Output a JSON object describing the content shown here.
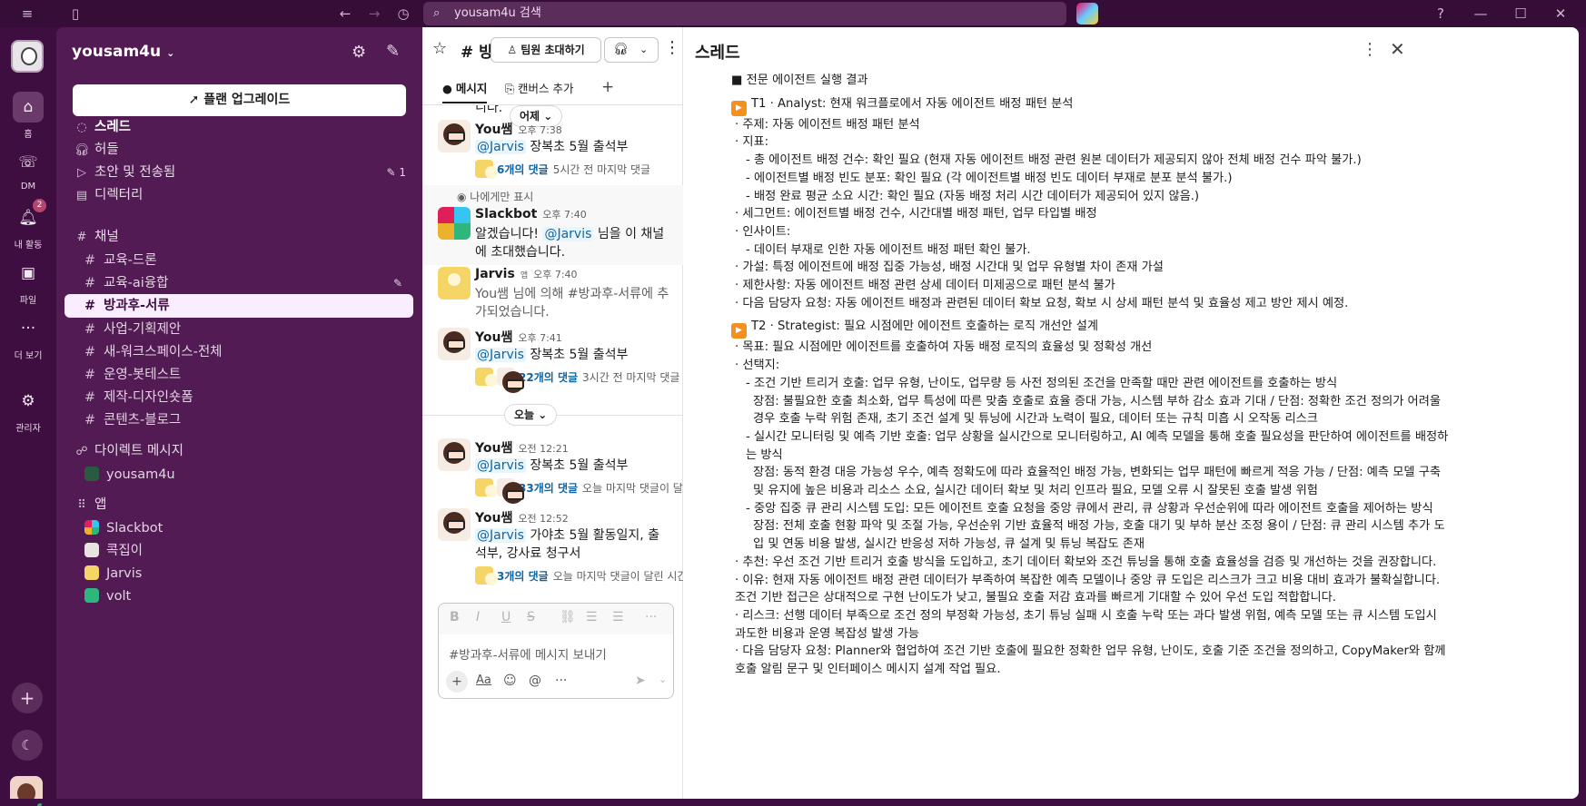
{
  "topbar": {
    "search_placeholder": "yousam4u 검색"
  },
  "rail": {
    "items": [
      {
        "label": "홈"
      },
      {
        "label": "DM"
      },
      {
        "label": "내 활동",
        "badge": "2"
      },
      {
        "label": "파일"
      },
      {
        "label": "더 보기"
      },
      {
        "label": "관리자"
      }
    ]
  },
  "sidebar": {
    "workspace": "yousam4u",
    "upgrade": "플랜 업그레이드",
    "nav": [
      {
        "label": "스레드"
      },
      {
        "label": "허들"
      },
      {
        "label": "초안 및 전송됨",
        "count": "1"
      },
      {
        "label": "디렉터리"
      }
    ],
    "channels_header": "채널",
    "channels": [
      {
        "label": "교육-드론"
      },
      {
        "label": "교육-ai융합"
      },
      {
        "label": "방과후-서류"
      },
      {
        "label": "사업-기획제안"
      },
      {
        "label": "새-워크스페이스-전체"
      },
      {
        "label": "운영-봇테스트"
      },
      {
        "label": "제작-디자인숏폼"
      },
      {
        "label": "콘텐츠-블로그"
      }
    ],
    "dm_header": "다이렉트 메시지",
    "dms": [
      {
        "label": "yousam4u"
      }
    ],
    "apps_header": "앱",
    "apps": [
      {
        "label": "Slackbot"
      },
      {
        "label": "콕집이"
      },
      {
        "label": "Jarvis"
      },
      {
        "label": "volt"
      }
    ]
  },
  "channel": {
    "name": "# 방과후-서류",
    "invite": "팀원 초대하기",
    "tabs": [
      {
        "label": "메시지"
      },
      {
        "label": "캔버스 추가"
      }
    ],
    "truncated_top": "니다.",
    "day_yesterday": "어제",
    "day_today": "오늘",
    "only_me": "나에게만 표시",
    "messages": [
      {
        "name": "You쌤",
        "time": "오후 7:38",
        "mention": "@Jarvis",
        "text": " 장복초 5월 출석부",
        "replies": "6개의 댓글",
        "ago": "5시간 전 마지막 댓글"
      },
      {
        "name": "Slackbot",
        "time": "오후 7:40",
        "text_pre": "알겠습니다! ",
        "mention": "@Jarvis",
        "text": " 님을 이 채널에 초대했습니다."
      },
      {
        "name": "Jarvis",
        "app_tag": "앱",
        "time": "오후 7:40",
        "text": "You쌤 님에 의해 #방과후-서류에 추가되었습니다."
      },
      {
        "name": "You쌤",
        "time": "오후 7:41",
        "mention": "@Jarvis",
        "text": " 장복초 5월 출석부",
        "replies": "22개의 댓글",
        "ago": "3시간 전 마지막 댓글"
      },
      {
        "name": "You쌤",
        "time": "오전 12:21",
        "mention": "@Jarvis",
        "text": " 장복초 5월 출석부",
        "replies": "33개의 댓글",
        "ago": "오늘 마지막 댓글이 달..."
      },
      {
        "name": "You쌤",
        "time": "오전 12:52",
        "mention": "@Jarvis",
        "text": " 가야초 5월 활동일지, 출석부, 강사료 청구서",
        "replies": "3개의 댓글",
        "ago": "오늘 마지막 댓글이 달린 시간..."
      }
    ],
    "composer_placeholder": "#방과후-서류에 메시지 보내기"
  },
  "thread": {
    "title": "스레드",
    "lines": [
      {
        "t": "■ 전문 에이전트 실행 결과",
        "c": "ind0"
      },
      {
        "t": "T1 · Analyst: 현재 워크플로에서 자동 에이전트 배정 패턴 분석",
        "c": "head",
        "play": true
      },
      {
        "t": " · 주제: 자동 에이전트 배정 패턴 분석",
        "c": "ind1"
      },
      {
        "t": " · 지표:",
        "c": "ind1"
      },
      {
        "t": "   - 총 에이전트 배정 건수: 확인 필요 (현재 자동 에이전트 배정 관련 원본 데이터가 제공되지 않아 전체 배정 건수 파악 불가.)",
        "c": "ind2"
      },
      {
        "t": "   - 에이전트별 배정 빈도 분포: 확인 필요 (각 에이전트별 배정 빈도 데이터 부재로 분포 분석 불가.)",
        "c": "ind2"
      },
      {
        "t": "   - 배정 완료 평균 소요 시간: 확인 필요 (자동 배정 처리 시간 데이터가 제공되어 있지 않음.)",
        "c": "ind2"
      },
      {
        "t": " · 세그먼트: 에이전트별 배정 건수, 시간대별 배정 패턴, 업무 타입별 배정",
        "c": "ind1"
      },
      {
        "t": " · 인사이트:",
        "c": "ind1"
      },
      {
        "t": "   - 데이터 부재로 인한 자동 에이전트 배정 패턴 확인 불가.",
        "c": "ind2"
      },
      {
        "t": " · 가설: 특정 에이전트에 배정 집중 가능성, 배정 시간대 및 업무 유형별 차이 존재 가설",
        "c": "ind1"
      },
      {
        "t": " · 제한사항: 자동 에이전트 배정 관련 상세 데이터 미제공으로 패턴 분석 불가",
        "c": "ind1"
      },
      {
        "t": " · 다음 담당자 요청: 자동 에이전트 배정과 관련된 데이터 확보 요청, 확보 시 상세 패턴 분석 및 효율성 제고 방안 제시 예정.",
        "c": "ind1"
      },
      {
        "t": "T2 · Strategist: 필요 시점에만 에이전트 호출하는 로직 개선안 설계",
        "c": "head",
        "play": true
      },
      {
        "t": " · 목표: 필요 시점에만 에이전트를 호출하여 자동 배정 로직의 효율성 및 정확성 개선",
        "c": "ind1"
      },
      {
        "t": " · 선택지:",
        "c": "ind1"
      },
      {
        "t": "   - 조건 기반 트리거 호출: 업무 유형, 난이도, 업무량 등 사전 정의된 조건을 만족할 때만 관련 에이전트를 호출하는 방식",
        "c": "ind2"
      },
      {
        "t": "      장점: 불필요한 호출 최소화, 업무 특성에 따른 맞춤 호출로 효율 증대 가능, 시스템 부하 감소 효과 기대 / 단점: 정확한 조건 정의가 어려울 경우 호출 누락 위험 존재, 초기 조건 설계 및 튜닝에 시간과 노력이 필요, 데이터 또는 규칙 미흡 시 오작동 리스크",
        "c": "ind3 wrap"
      },
      {
        "t": "   - 실시간 모니터링 및 예측 기반 호출: 업무 상황을 실시간으로 모니터링하고, AI 예측 모델을 통해 호출 필요성을 판단하여 에이전트를 배정하는 방식",
        "c": "ind2 wrap"
      },
      {
        "t": "      장점: 동적 환경 대응 가능성 우수, 예측 정확도에 따라 효율적인 배정 가능, 변화되는 업무 패턴에 빠르게 적응 가능 / 단점: 예측 모델 구축 및 유지에 높은 비용과 리소스 소요, 실시간 데이터 확보 및 처리 인프라 필요, 모델 오류 시 잘못된 호출 발생 위험",
        "c": "ind3 wrap"
      },
      {
        "t": "   - 중앙 집중 큐 관리 시스템 도입: 모든 에이전트 호출 요청을 중앙 큐에서 관리, 큐 상황과 우선순위에 따라 에이전트 호출을 제어하는 방식",
        "c": "ind2 wrap"
      },
      {
        "t": "      장점: 전체 호출 현황 파악 및 조절 가능, 우선순위 기반 효율적 배정 가능, 호출 대기 및 부하 분산 조정 용이 / 단점: 큐 관리 시스템 추가 도입 및 연동 비용 발생, 실시간 반응성 저하 가능성, 큐 설계 및 튜닝 복잡도 존재",
        "c": "ind3 wrap"
      },
      {
        "t": " · 추천: 우선 조건 기반 트리거 호출 방식을 도입하고, 초기 데이터 확보와 조건 튜닝을 통해 호출 효율성을 검증 및 개선하는 것을 권장합니다.",
        "c": "ind1 wrap"
      },
      {
        "t": " · 이유: 현재 자동 에이전트 배정 관련 데이터가 부족하여 복잡한 예측 모델이나 중앙 큐 도입은 리스크가 크고 비용 대비 효과가 불확실합니다. 조건 기반 접근은 상대적으로 구현 난이도가 낮고, 불필요 호출 저감 효과를 빠르게 기대할 수 있어 우선 도입 적합합니다.",
        "c": "ind1 wrap"
      },
      {
        "t": " · 리스크: 선행 데이터 부족으로 조건 정의 부정확 가능성, 초기 튜닝 실패 시 호출 누락 또는 과다 발생 위험, 예측 모델 또는 큐 시스템 도입시 과도한 비용과 운영 복잡성 발생 가능",
        "c": "ind1 wrap"
      },
      {
        "t": " · 다음 담당자 요청: Planner와 협업하여 조건 기반 호출에 필요한 정확한 업무 유형, 난이도, 호출 기준 조건을 정의하고, CopyMaker와 함께 호출 알림 문구 및 인터페이스 메시지 설계 작업 필요.",
        "c": "ind1 wrap"
      }
    ]
  },
  "colors": {
    "aubergine": "#3f0e40",
    "sidebar": "#521b53",
    "active_channel": "#f9edff",
    "link": "#1264a3",
    "play": "#f4901e"
  }
}
